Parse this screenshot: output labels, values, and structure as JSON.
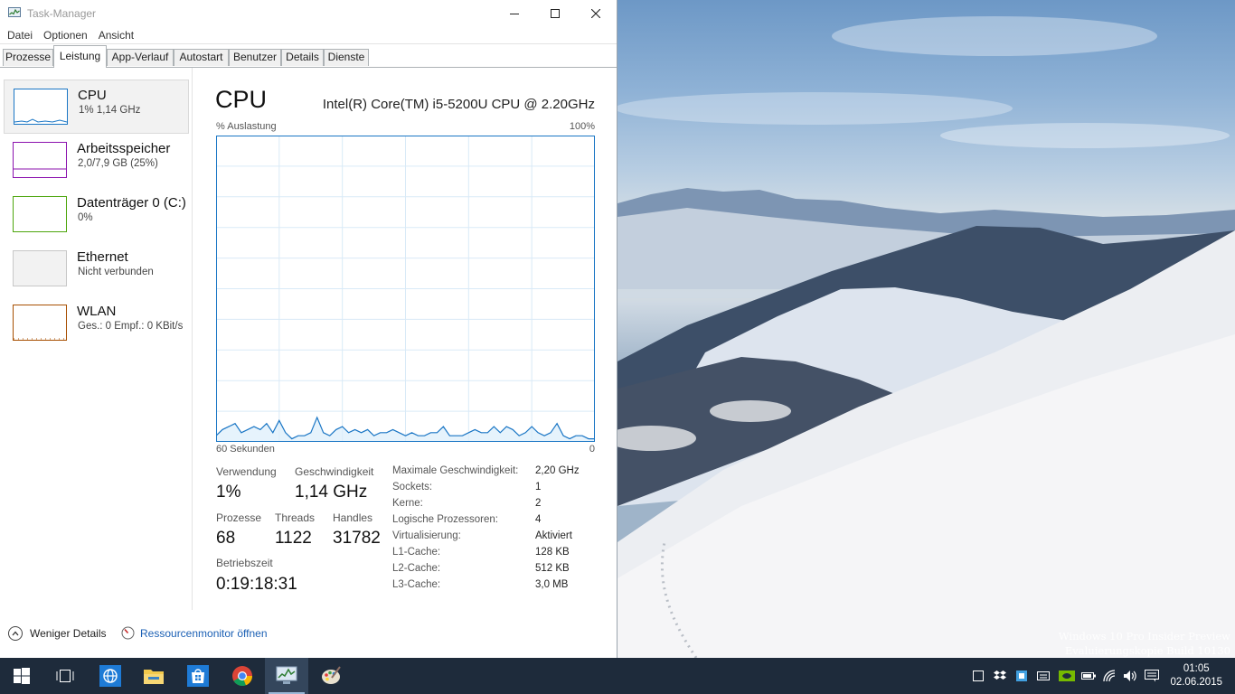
{
  "window": {
    "title": "Task-Manager"
  },
  "menu": [
    "Datei",
    "Optionen",
    "Ansicht"
  ],
  "tabs": [
    "Prozesse",
    "Leistung",
    "App-Verlauf",
    "Autostart",
    "Benutzer",
    "Details",
    "Dienste"
  ],
  "active_tab": "Leistung",
  "sidebar": [
    {
      "title": "CPU",
      "sub": "1% 1,14 GHz",
      "color": "#1a76c5"
    },
    {
      "title": "Arbeitsspeicher",
      "sub": "2,0/7,9 GB (25%)",
      "color": "#8b12ae"
    },
    {
      "title": "Datenträger 0 (C:)",
      "sub": "0%",
      "color": "#4da60c"
    },
    {
      "title": "Ethernet",
      "sub": "Nicht verbunden",
      "color": "#c7c7c7"
    },
    {
      "title": "WLAN",
      "sub": "Ges.: 0 Empf.: 0 KBit/s",
      "color": "#a74f01"
    }
  ],
  "detail": {
    "heading": "CPU",
    "model": "Intel(R) Core(TM) i5-5200U CPU @ 2.20GHz",
    "axis_top_left": "% Auslastung",
    "axis_top_right": "100%",
    "axis_bottom_left": "60 Sekunden",
    "axis_bottom_right": "0",
    "stats": {
      "verwendung_label": "Verwendung",
      "verwendung": "1%",
      "geschwindigkeit_label": "Geschwindigkeit",
      "geschwindigkeit": "1,14 GHz",
      "prozesse_label": "Prozesse",
      "prozesse": "68",
      "threads_label": "Threads",
      "threads": "1122",
      "handles_label": "Handles",
      "handles": "31782",
      "betriebszeit_label": "Betriebszeit",
      "betriebszeit": "0:19:18:31"
    },
    "properties": [
      {
        "label": "Maximale Geschwindigkeit:",
        "value": "2,20 GHz"
      },
      {
        "label": "Sockets:",
        "value": "1"
      },
      {
        "label": "Kerne:",
        "value": "2"
      },
      {
        "label": "Logische Prozessoren:",
        "value": "4"
      },
      {
        "label": "Virtualisierung:",
        "value": "Aktiviert"
      },
      {
        "label": "L1-Cache:",
        "value": "128 KB"
      },
      {
        "label": "L2-Cache:",
        "value": "512 KB"
      },
      {
        "label": "L3-Cache:",
        "value": "3,0 MB"
      }
    ]
  },
  "footer": {
    "fewer_details": "Weniger Details",
    "resource_monitor": "Ressourcenmonitor öffnen"
  },
  "chart_data": {
    "type": "line",
    "ylabel": "% Auslastung",
    "xlabel": "60 Sekunden",
    "ylim": [
      0,
      100
    ],
    "x_range": [
      60,
      0
    ],
    "series": [
      {
        "values": [
          2,
          4,
          5,
          6,
          3,
          4,
          5,
          4,
          6,
          3,
          7,
          3,
          1,
          2,
          2,
          3,
          8,
          3,
          2,
          4,
          5,
          3,
          4,
          3,
          4,
          2,
          3,
          3,
          4,
          3,
          2,
          3,
          2,
          2,
          3,
          3,
          5,
          2,
          2,
          2,
          3,
          4,
          3,
          3,
          5,
          3,
          5,
          4,
          2,
          3,
          5,
          3,
          2,
          3,
          6,
          2,
          1,
          2,
          2,
          1,
          1
        ]
      }
    ]
  },
  "desktop": {
    "watermark_line1": "Windows 10 Pro Insider Preview",
    "watermark_line2": "Evaluierungskopie Build 10130"
  },
  "taskbar": {
    "apps": [
      "start-button",
      "task-view",
      "internet-explorer",
      "file-explorer",
      "store",
      "chrome",
      "task-manager",
      "paint"
    ],
    "time": "01:05",
    "date": "02.06.2015"
  }
}
